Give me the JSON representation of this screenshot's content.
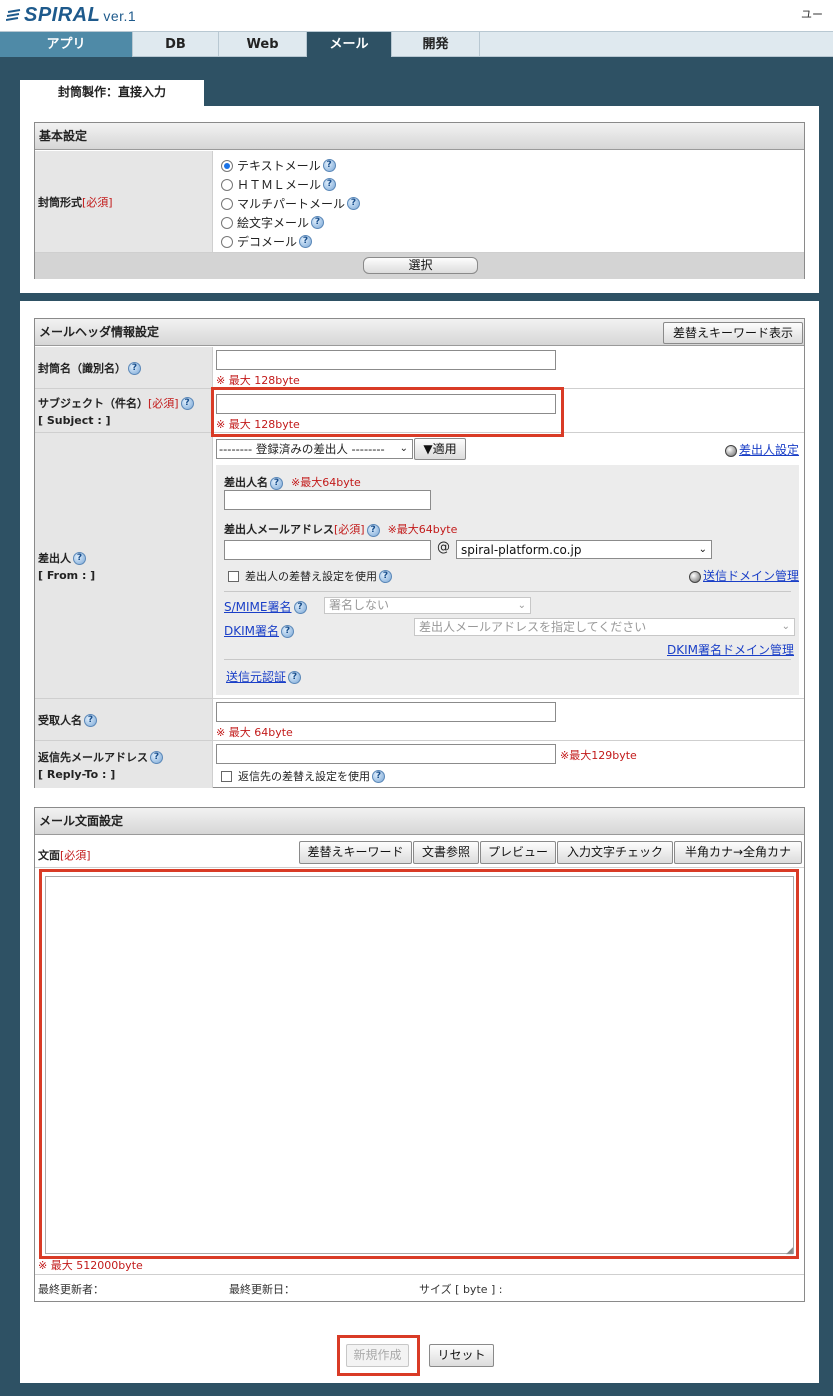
{
  "app": {
    "logo": "SPIRAL",
    "version": "ver.1",
    "user_edge": "ユー"
  },
  "nav": {
    "tabs": [
      "アプリ",
      "DB",
      "Web",
      "メール",
      "開発"
    ],
    "active": "メール"
  },
  "form_tab": "封筒製作：直接入力",
  "basic": {
    "title": "基本設定",
    "format_label": "封筒形式",
    "required": "[必須]",
    "options": [
      "テキストメール",
      "ＨＴＭＬメール",
      "マルチパートメール",
      "絵文字メール",
      "デコメール"
    ],
    "selected_index": 0,
    "select_button": "選択"
  },
  "header": {
    "title": "メールヘッダ情報設定",
    "keyword_button": "差替えキーワード表示",
    "envelope_name_label": "封筒名（識別名）",
    "envelope_name_value": "",
    "envelope_name_note": "※ 最大 128byte",
    "subject_label": "サブジェクト（件名）",
    "subject_sub": "[ Subject : ]",
    "subject_value": "",
    "subject_note": "※ 最大 128byte",
    "from_label": "差出人",
    "from_sub": "[ From : ]",
    "registered_sender": "-------- 登録済みの差出人 --------",
    "apply_button": "▼適用",
    "sender_settings_link": "差出人設定",
    "sender_name_label": "差出人名",
    "sender_name_note": "※最大64byte",
    "sender_name_value": "",
    "sender_address_label": "差出人メールアドレス",
    "sender_address_note": "※最大64byte",
    "sender_address_value": "",
    "at": "@",
    "domain": "spiral-platform.co.jp",
    "sender_replace_checkbox": "差出人の差替え設定を使用",
    "send_domain_link": "送信ドメイン管理",
    "smime_label": "S/MIME署名",
    "smime_value": "署名しない",
    "dkim_label": "DKIM署名",
    "dkim_value": "差出人メールアドレスを指定してください",
    "dkim_domain_link": "DKIM署名ドメイン管理",
    "sender_auth_link": "送信元認証",
    "recipient_label": "受取人名",
    "recipient_value": "",
    "recipient_note": "※ 最大 64byte",
    "reply_label": "返信先メールアドレス",
    "reply_sub": "[ Reply-To : ]",
    "reply_value": "",
    "reply_note": "※最大129byte",
    "reply_checkbox": "返信先の差替え設定を使用"
  },
  "body": {
    "title": "メール文面設定",
    "text_label": "文面",
    "buttons": [
      "差替えキーワード",
      "文書参照",
      "プレビュー",
      "入力文字チェック",
      "半角カナ→全角カナ"
    ],
    "text_value": "",
    "note": "※ 最大 512000byte",
    "updated_by": "最終更新者：",
    "updated_at": "最終更新日：",
    "size": "サイズ [ byte ] :"
  },
  "actions": {
    "create": "新規作成",
    "reset": "リセット"
  }
}
